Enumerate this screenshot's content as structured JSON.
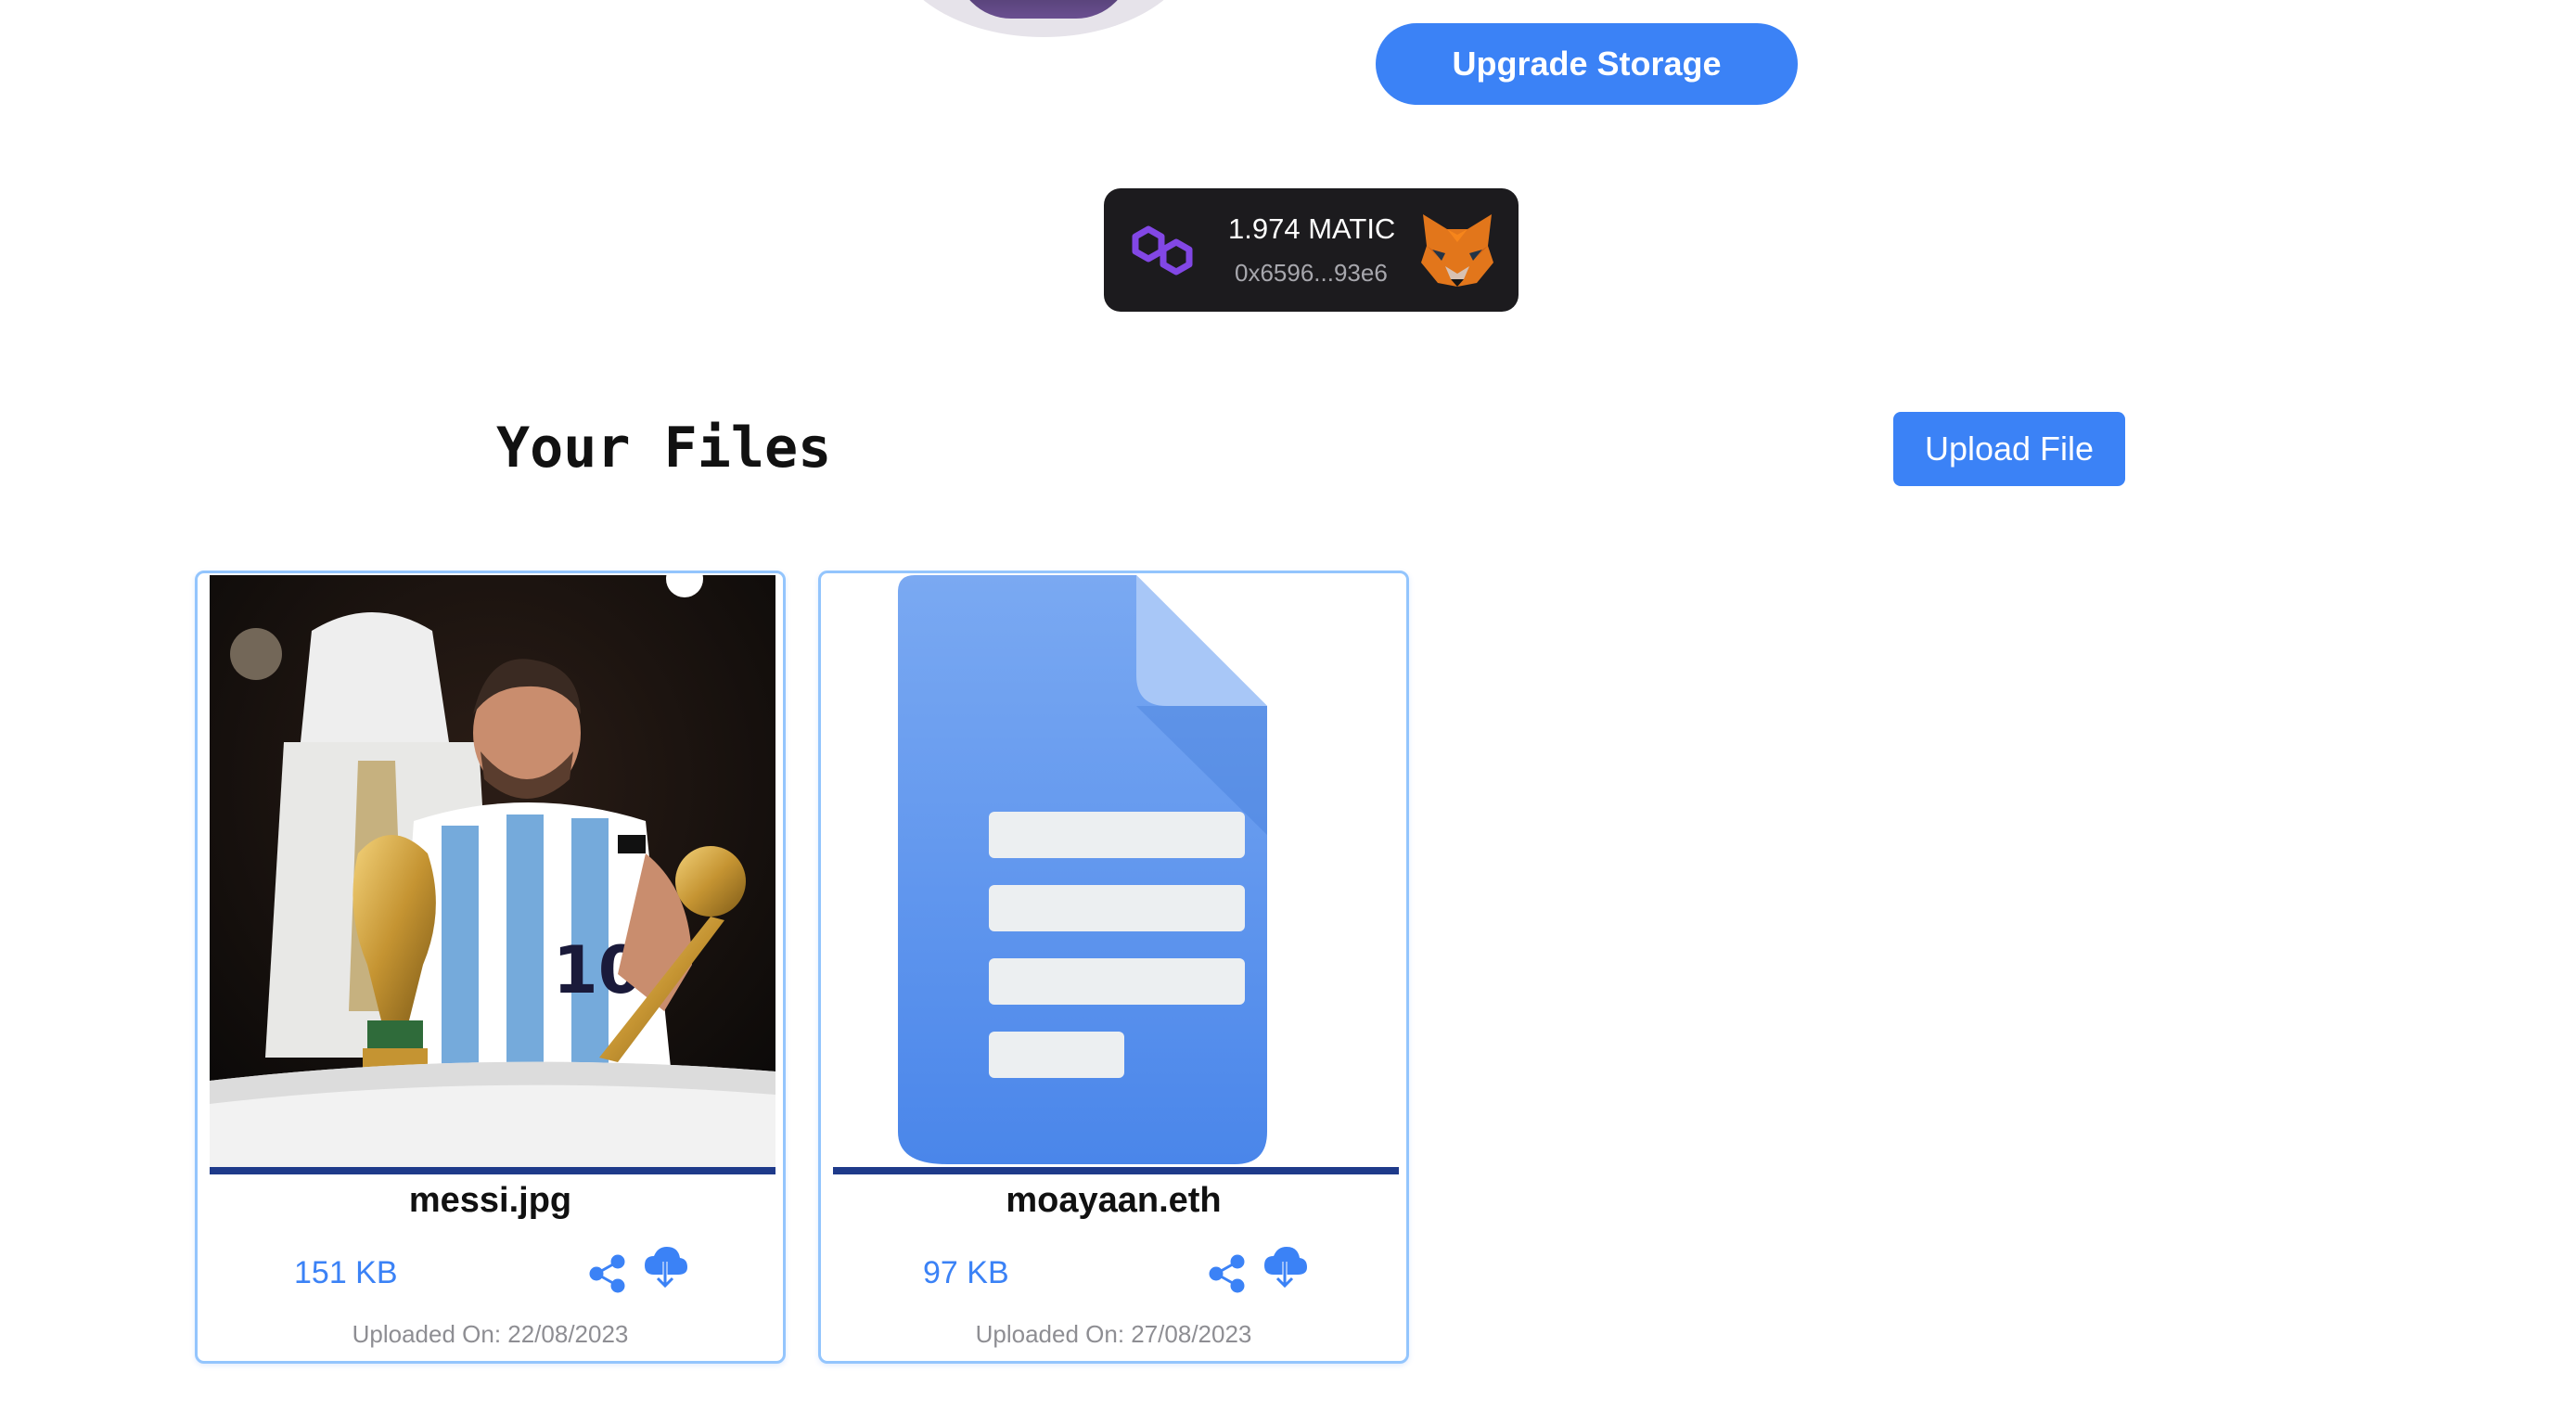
{
  "header": {
    "upgrade_label": "Upgrade Storage"
  },
  "wallet": {
    "balance": "1.974 MATIC",
    "address": "0x6596...93e6",
    "network_icon": "polygon-icon",
    "wallet_icon": "metamask-fox-icon"
  },
  "files_section": {
    "title": "Your Files",
    "upload_label": "Upload File"
  },
  "files": [
    {
      "name": "messi.jpg",
      "size": "151 KB",
      "uploaded": "Uploaded On: 22/08/2023",
      "thumbnail": "photo"
    },
    {
      "name": "moayaan.eth",
      "size": "97 KB",
      "uploaded": "Uploaded On: 27/08/2023",
      "thumbnail": "document-icon"
    }
  ],
  "colors": {
    "accent": "#3b82f6",
    "card_border": "#93c5fd",
    "thumb_underline": "#1e3a8a",
    "wallet_bg": "#1c1b1e",
    "polygon": "#8247e5"
  }
}
